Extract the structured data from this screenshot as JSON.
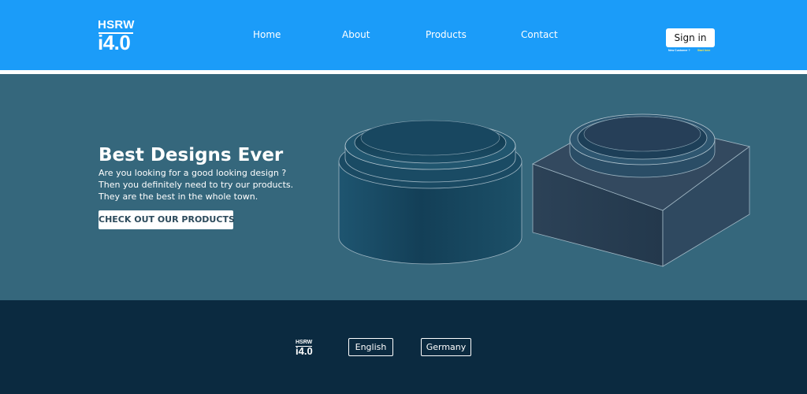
{
  "brand": {
    "line1": "HSRW",
    "line2": "i4.0"
  },
  "nav": {
    "items": [
      {
        "label": "Home"
      },
      {
        "label": "About"
      },
      {
        "label": "Products"
      },
      {
        "label": "Contact"
      }
    ]
  },
  "auth": {
    "signin_label": "Sign in",
    "new_customer": "New Customer ?",
    "start_here": "Start here"
  },
  "hero": {
    "title": "Best Designs Ever",
    "lines": [
      "Are you looking for a good looking design ?",
      "Then you definitely need to try our products.",
      "They are the best in the whole town."
    ],
    "cta_label": "CHECK OUT OUR PRODUCTS"
  },
  "footer": {
    "brand": {
      "line1": "HSRW",
      "line2": "i4.0"
    },
    "languages": [
      {
        "label": "English"
      },
      {
        "label": "Germany"
      }
    ]
  },
  "colors": {
    "header": "#1b9cf9",
    "hero": "#35677c",
    "footer": "#0b2a40",
    "accent_yellow": "#ffe94a"
  }
}
